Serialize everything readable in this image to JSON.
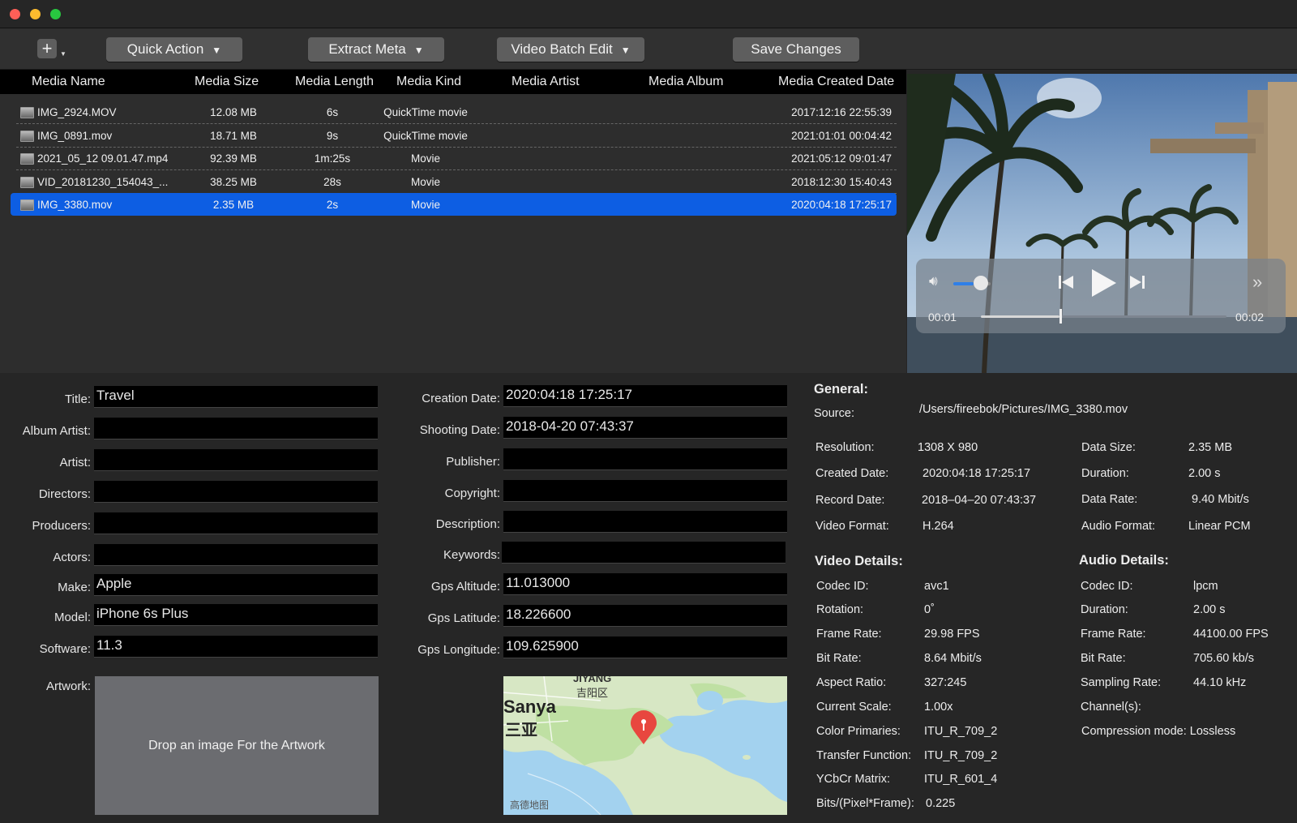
{
  "toolbar": {
    "add_label": "+",
    "quick_action": "Quick Action",
    "extract_meta": "Extract Meta",
    "video_batch_edit": "Video Batch Edit",
    "save_changes": "Save Changes"
  },
  "table": {
    "headers": [
      "Media Name",
      "Media Size",
      "Media Length",
      "Media Kind",
      "Media Artist",
      "Media Album",
      "Media Created Date"
    ],
    "rows": [
      {
        "name": "IMG_2924.MOV",
        "size": "12.08 MB",
        "length": "6s",
        "kind": "QuickTime movie",
        "artist": "",
        "album": "",
        "created": "2017:12:16 22:55:39"
      },
      {
        "name": "IMG_0891.mov",
        "size": "18.71 MB",
        "length": "9s",
        "kind": "QuickTime movie",
        "artist": "",
        "album": "",
        "created": "2021:01:01 00:04:42"
      },
      {
        "name": "2021_05_12 09.01.47.mp4",
        "size": "92.39 MB",
        "length": "1m:25s",
        "kind": "Movie",
        "artist": "",
        "album": "",
        "created": "2021:05:12 09:01:47"
      },
      {
        "name": "VID_20181230_154043_...",
        "size": "38.25 MB",
        "length": "28s",
        "kind": "Movie",
        "artist": "",
        "album": "",
        "created": "2018:12:30 15:40:43"
      },
      {
        "name": "IMG_3380.mov",
        "size": "2.35 MB",
        "length": "2s",
        "kind": "Movie",
        "artist": "",
        "album": "",
        "created": "2020:04:18 17:25:17"
      }
    ],
    "selected_index": 4
  },
  "player": {
    "current_time": "00:01",
    "total_time": "00:02",
    "progress": 0.32,
    "volume": 0.55
  },
  "metadata_left": {
    "title_label": "Title:",
    "title": "Travel",
    "album_artist_label": "Album Artist:",
    "album_artist": "",
    "artist_label": "Artist:",
    "artist": "",
    "directors_label": "Directors:",
    "directors": "",
    "producers_label": "Producers:",
    "producers": "",
    "actors_label": "Actors:",
    "actors": "",
    "make_label": "Make:",
    "make": "Apple",
    "model_label": "Model:",
    "model": "iPhone 6s Plus",
    "software_label": "Software:",
    "software": "11.3",
    "artwork_label": "Artwork:",
    "artwork_placeholder": "Drop an image For the Artwork"
  },
  "metadata_mid": {
    "creation_date_label": "Creation Date:",
    "creation_date": "2020:04:18 17:25:17",
    "shooting_date_label": "Shooting Date:",
    "shooting_date": "2018-04-20 07:43:37",
    "publisher_label": "Publisher:",
    "publisher": "",
    "copyright_label": "Copyright:",
    "copyright": "",
    "description_label": "Description:",
    "description": "",
    "keywords_label": "Keywords:",
    "keywords": "",
    "gps_altitude_label": "Gps Altitude:",
    "gps_altitude": "11.013000",
    "gps_latitude_label": "Gps Latitude:",
    "gps_latitude": "18.226600",
    "gps_longitude_label": "Gps Longitude:",
    "gps_longitude": "109.625900"
  },
  "map": {
    "city_en": "Sanya",
    "city_zh": "三亚",
    "district_en": "JIYANG",
    "district_zh": "吉阳区",
    "provider": "高德地图"
  },
  "info": {
    "general_head": "General:",
    "source_label": "Source:",
    "source": "/Users/fireebok/Pictures/IMG_3380.mov",
    "resolution_label": "Resolution:",
    "resolution": "1308 X 980",
    "created_date_label": "Created Date:",
    "created_date": "2020:04:18 17:25:17",
    "record_date_label": "Record Date:",
    "record_date": "2018–04–20 07:43:37",
    "video_format_label": "Video Format:",
    "video_format": "H.264",
    "data_size_label": "Data Size:",
    "data_size": "2.35 MB",
    "duration_label": "Duration:",
    "duration": "2.00 s",
    "data_rate_label": "Data Rate:",
    "data_rate": "9.40 Mbit/s",
    "audio_format_label": "Audio Format:",
    "audio_format": "Linear PCM",
    "video_details_head": "Video Details:",
    "v_codec_label": "Codec ID:",
    "v_codec": "avc1",
    "v_rotation_label": "Rotation:",
    "v_rotation": "0˚",
    "v_frame_rate_label": "Frame Rate:",
    "v_frame_rate": "29.98 FPS",
    "v_bit_rate_label": "Bit Rate:",
    "v_bit_rate": "8.64 Mbit/s",
    "v_aspect_label": "Aspect Ratio:",
    "v_aspect": "327:245",
    "v_scale_label": "Current Scale:",
    "v_scale": "1.00x",
    "v_primaries_label": "Color Primaries:",
    "v_primaries": "ITU_R_709_2",
    "v_transfer_label": "Transfer Function:",
    "v_transfer": "ITU_R_709_2",
    "v_ycbcr_label": "YCbCr Matrix:",
    "v_ycbcr": "ITU_R_601_4",
    "v_bits_label": "Bits/(Pixel*Frame):",
    "v_bits": "0.225",
    "audio_details_head": "Audio Details:",
    "a_codec_label": "Codec ID:",
    "a_codec": "lpcm",
    "a_duration_label": "Duration:",
    "a_duration": "2.00 s",
    "a_frame_rate_label": "Frame Rate:",
    "a_frame_rate": "44100.00 FPS",
    "a_bit_rate_label": "Bit Rate:",
    "a_bit_rate": "705.60 kb/s",
    "a_sampling_label": "Sampling Rate:",
    "a_sampling": "44.10 kHz",
    "a_channels_label": "Channel(s):",
    "a_compression": "Compression mode: Lossless"
  },
  "colors": {
    "selection": "#0d5ee3",
    "panel": "#262626",
    "field": "#000000",
    "map_pin": "#e8473f"
  }
}
